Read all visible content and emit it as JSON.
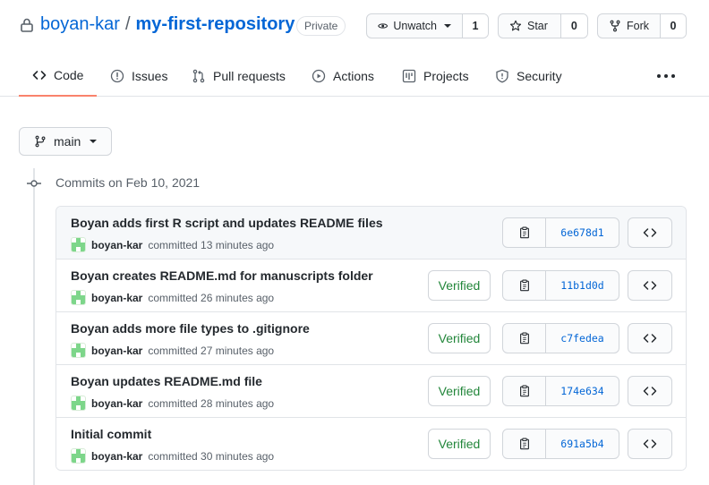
{
  "repo": {
    "owner": "boyan-kar",
    "separator": "/",
    "name": "my-first-repository",
    "visibility": "Private"
  },
  "actions": {
    "watch": {
      "label": "Unwatch",
      "count": "1"
    },
    "star": {
      "label": "Star",
      "count": "0"
    },
    "fork": {
      "label": "Fork",
      "count": "0"
    }
  },
  "tabs": [
    {
      "label": "Code",
      "icon": "code-icon",
      "active": true
    },
    {
      "label": "Issues",
      "icon": "issue-icon"
    },
    {
      "label": "Pull requests",
      "icon": "pull-request-icon"
    },
    {
      "label": "Actions",
      "icon": "play-icon"
    },
    {
      "label": "Projects",
      "icon": "project-icon"
    },
    {
      "label": "Security",
      "icon": "shield-icon"
    }
  ],
  "branch": {
    "name": "main"
  },
  "commits_group": {
    "title": "Commits on Feb 10, 2021"
  },
  "commits": [
    {
      "message": "Boyan adds first R script and updates README files",
      "author": "boyan-kar",
      "time": "committed 13 minutes ago",
      "verified": "",
      "sha": "6e678d1"
    },
    {
      "message": "Boyan creates README.md for manuscripts folder",
      "author": "boyan-kar",
      "time": "committed 26 minutes ago",
      "verified": "Verified",
      "sha": "11b1d0d"
    },
    {
      "message": "Boyan adds more file types to .gitignore",
      "author": "boyan-kar",
      "time": "committed 27 minutes ago",
      "verified": "Verified",
      "sha": "c7fedea"
    },
    {
      "message": "Boyan updates README.md file",
      "author": "boyan-kar",
      "time": "committed 28 minutes ago",
      "verified": "Verified",
      "sha": "174e634"
    },
    {
      "message": "Initial commit",
      "author": "boyan-kar",
      "time": "committed 30 minutes ago",
      "verified": "Verified",
      "sha": "691a5b4"
    }
  ],
  "colors": {
    "link": "#0366d6",
    "verified": "#22863a",
    "active_tab": "#f9826c",
    "avatar": "#7dd68a"
  }
}
